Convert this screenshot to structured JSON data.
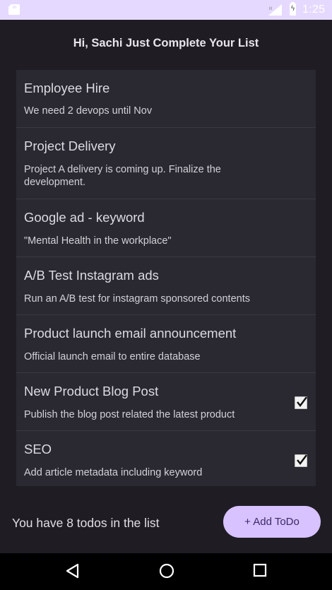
{
  "status_bar": {
    "time": "1:25",
    "icons": [
      "sd-card-icon",
      "signal-icon",
      "battery-icon"
    ],
    "background": "#e6d9ff"
  },
  "greeting": "Hi, Sachi Just Complete Your List",
  "todos": [
    {
      "title": "Employee Hire",
      "description": "We need 2 devops until Nov",
      "checked": false
    },
    {
      "title": "Project Delivery",
      "description": "Project A delivery is coming up. Finalize the development.",
      "checked": false
    },
    {
      "title": "Google ad - keyword",
      "description": "\"Mental Health in the workplace\"",
      "checked": false
    },
    {
      "title": "A/B Test Instagram ads",
      "description": "Run an A/B test for instagram sponsored contents",
      "checked": false
    },
    {
      "title": "Product launch email announcement",
      "description": "Official launch email to entire database",
      "checked": false
    },
    {
      "title": "New Product Blog Post",
      "description": "Publish the blog post related the latest product",
      "checked": true
    },
    {
      "title": "SEO",
      "description": "Add article metadata including keyword",
      "checked": true
    }
  ],
  "footer": {
    "count_text": "You have 8 todos in the list",
    "add_button_label": "+ Add ToDo"
  },
  "colors": {
    "background": "#1f1d23",
    "card": "#2a2830",
    "accent": "#d8c2ff"
  },
  "nav_bar": {
    "icons": [
      "back-icon",
      "home-icon",
      "recents-icon"
    ]
  }
}
